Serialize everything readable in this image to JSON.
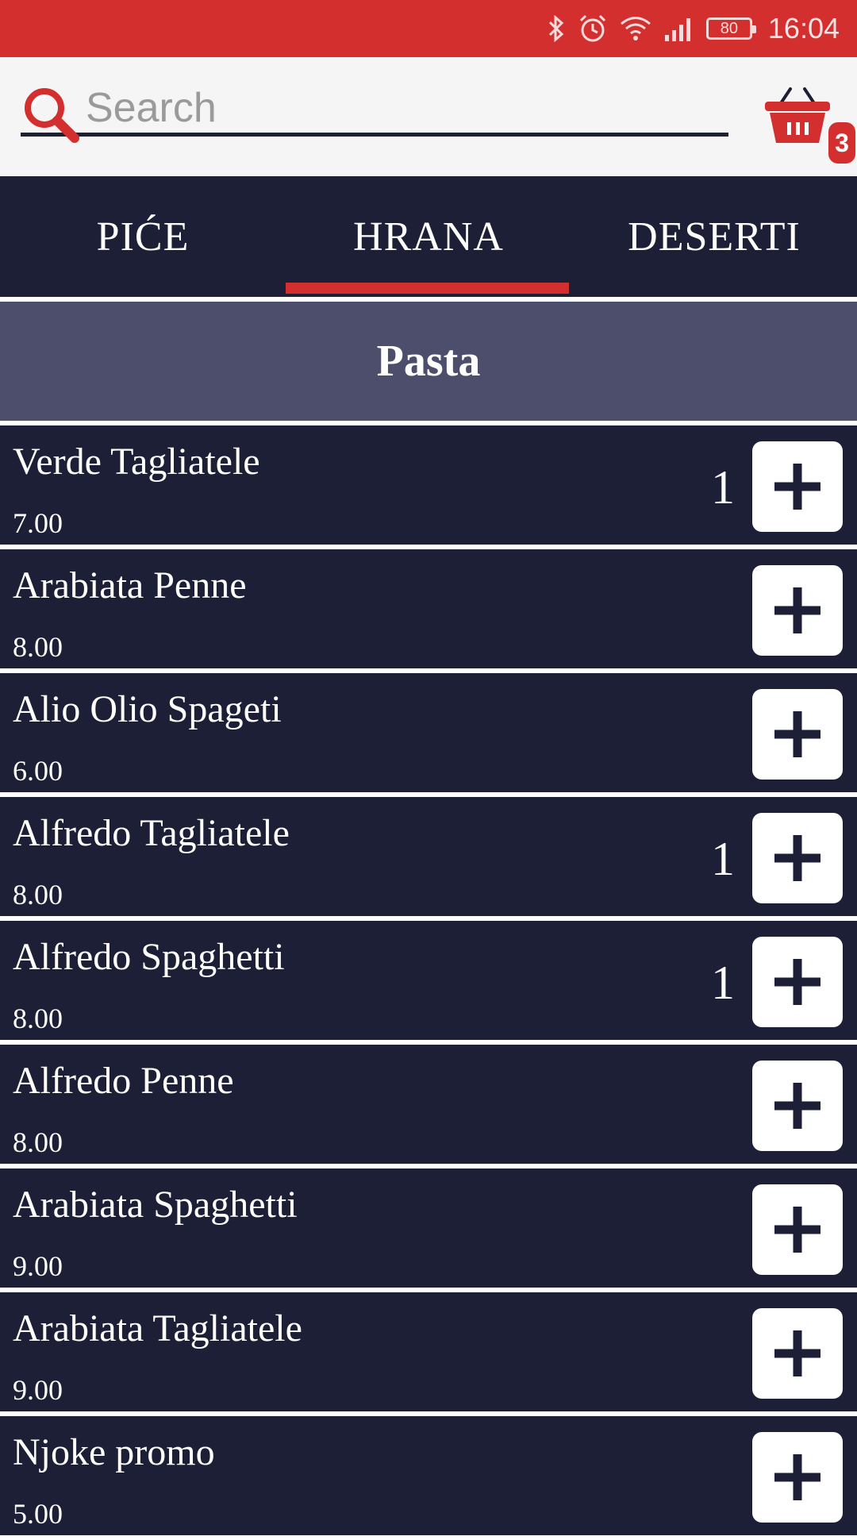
{
  "status_bar": {
    "battery": "80",
    "time": "16:04"
  },
  "search": {
    "placeholder": "Search",
    "value": ""
  },
  "cart": {
    "badge_count": "3"
  },
  "tabs": [
    {
      "label": "PIĆE",
      "selected": false
    },
    {
      "label": "HRANA",
      "selected": true
    },
    {
      "label": "DESERTI",
      "selected": false
    }
  ],
  "category": {
    "title": "Pasta"
  },
  "items": [
    {
      "name": "Verde Tagliatele",
      "price": "7.00",
      "qty": "1"
    },
    {
      "name": "Arabiata Penne",
      "price": "8.00",
      "qty": ""
    },
    {
      "name": "Alio Olio Spageti",
      "price": "6.00",
      "qty": ""
    },
    {
      "name": "Alfredo Tagliatele",
      "price": "8.00",
      "qty": "1"
    },
    {
      "name": "Alfredo Spaghetti",
      "price": "8.00",
      "qty": "1"
    },
    {
      "name": "Alfredo Penne",
      "price": "8.00",
      "qty": ""
    },
    {
      "name": "Arabiata Spaghetti",
      "price": "9.00",
      "qty": ""
    },
    {
      "name": "Arabiata Tagliatele",
      "price": "9.00",
      "qty": ""
    },
    {
      "name": "Njoke promo",
      "price": "5.00",
      "qty": ""
    }
  ],
  "colors": {
    "accent": "#d32f2f",
    "navy": "#1c1f35",
    "category_bg": "#4d4e6b",
    "header_bg": "#f5f5f5"
  },
  "icons": {
    "search": "search-icon",
    "cart": "basket-icon",
    "add": "plus-icon"
  }
}
